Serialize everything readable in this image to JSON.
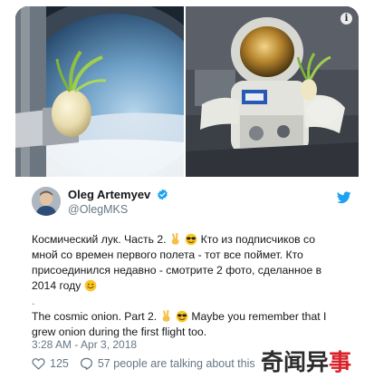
{
  "tweet": {
    "author": {
      "display_name": "Oleg Artemyev",
      "handle": "@OlegMKS",
      "verified": true
    },
    "text_ru_lines": [
      "Космический лук. Часть 2.",
      "Кто из подписчиков со",
      "мной со времен первого полета - тот все поймет. Кто",
      "присоединился недавно - смотрите 2 фото, сделанное в",
      "2014 году"
    ],
    "separator": ".",
    "text_en_lines": [
      "The cosmic onion. Part 2.",
      "Maybe you remember that I",
      "grew onion during the first flight too."
    ],
    "timestamp": "3:28 AM - Apr 3, 2018",
    "likes_count": "125",
    "talking_text": "57 people are talking about this"
  },
  "media": {
    "left_description_icon": "onion-porthole-photo",
    "right_description_icon": "spacesuit-onion-photo",
    "info_icon": "i"
  },
  "watermark": {
    "main": "奇闻异",
    "accent": "事"
  },
  "colors": {
    "brand_blue": "#1da1f2",
    "secondary_text": "#657786",
    "primary_text": "#14171a",
    "heart": "#657786",
    "watermark_accent": "#d8222a"
  },
  "icons": {
    "verified": "verified-badge-icon",
    "twitter": "twitter-bird-icon",
    "heart": "heart-icon",
    "reply": "reply-icon",
    "emoji_victory": "victory-hand-emoji",
    "emoji_sunglasses": "sunglasses-emoji",
    "emoji_smile": "smile-emoji"
  }
}
